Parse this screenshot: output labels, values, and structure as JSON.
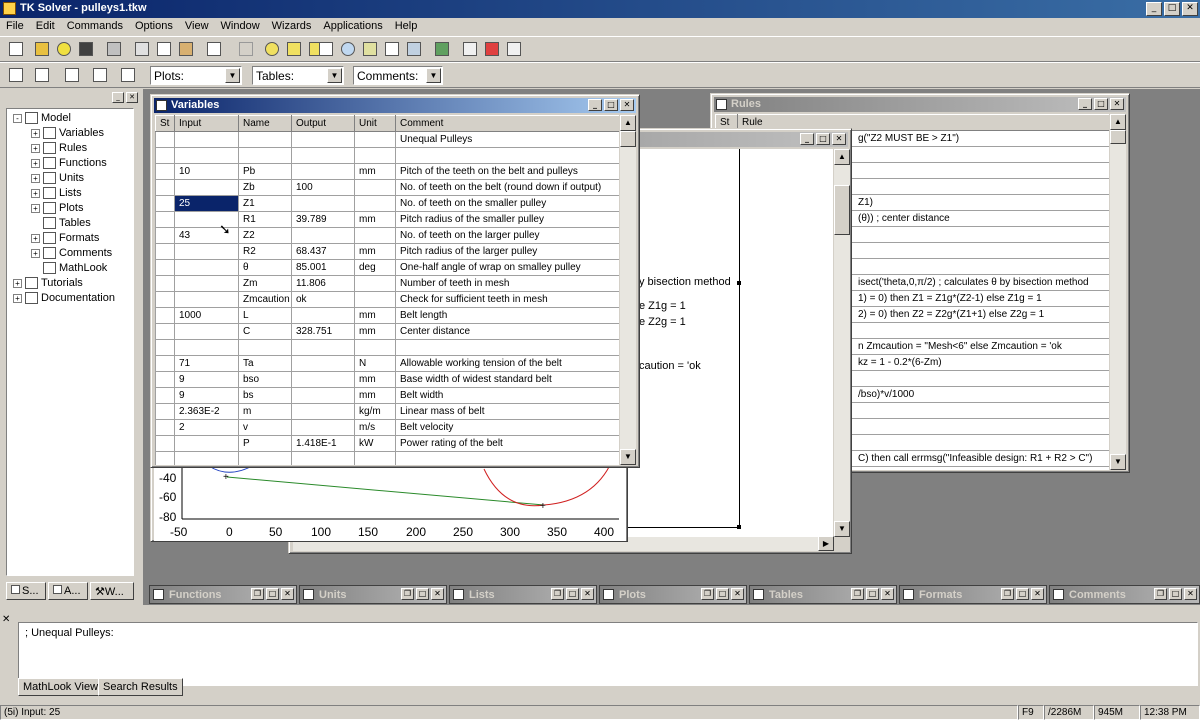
{
  "app": {
    "title": "TK Solver - pulleys1.tkw",
    "menu": [
      "File",
      "Edit",
      "Commands",
      "Options",
      "View",
      "Window",
      "Wizards",
      "Applications",
      "Help"
    ]
  },
  "toolbar2": {
    "plots": "Plots:",
    "tables": "Tables:",
    "comments": "Comments:"
  },
  "tree": {
    "items": [
      {
        "label": "Model",
        "level": 0,
        "expander": "-",
        "icon": "model-icon"
      },
      {
        "label": "Variables",
        "level": 1,
        "expander": "+",
        "icon": "variables-icon"
      },
      {
        "label": "Rules",
        "level": 1,
        "expander": "+",
        "icon": "rules-icon"
      },
      {
        "label": "Functions",
        "level": 1,
        "expander": "+",
        "icon": "functions-icon"
      },
      {
        "label": "Units",
        "level": 1,
        "expander": "+",
        "icon": "units-icon"
      },
      {
        "label": "Lists",
        "level": 1,
        "expander": "+",
        "icon": "lists-icon"
      },
      {
        "label": "Plots",
        "level": 1,
        "expander": "+",
        "icon": "plots-icon"
      },
      {
        "label": "Tables",
        "level": 1,
        "expander": "",
        "icon": "tables-icon"
      },
      {
        "label": "Formats",
        "level": 1,
        "expander": "+",
        "icon": "formats-icon"
      },
      {
        "label": "Comments",
        "level": 1,
        "expander": "+",
        "icon": "comments-icon"
      },
      {
        "label": "MathLook",
        "level": 1,
        "expander": "",
        "icon": "mathlook-icon"
      },
      {
        "label": "Tutorials",
        "level": 0,
        "expander": "+",
        "icon": "tutorials-icon"
      },
      {
        "label": "Documentation",
        "level": 0,
        "expander": "+",
        "icon": "documentation-icon"
      }
    ],
    "tabs": [
      "S...",
      "A...",
      "W..."
    ]
  },
  "variables": {
    "title": "Variables",
    "headers": [
      "St",
      "Input",
      "Name",
      "Output",
      "Unit",
      "Comment"
    ],
    "rows": [
      [
        "",
        "",
        "",
        "",
        "",
        "Unequal Pulleys"
      ],
      [
        "",
        "",
        "",
        "",
        "",
        ""
      ],
      [
        "",
        "10",
        "Pb",
        "",
        "mm",
        "Pitch of the teeth on the belt and pulleys"
      ],
      [
        "",
        "",
        "Zb",
        "100",
        "",
        "No. of teeth on the belt (round down if output)"
      ],
      [
        "",
        "25",
        "Z1",
        "",
        "",
        "No. of teeth on the smaller pulley"
      ],
      [
        "",
        "",
        "R1",
        "39.789",
        "mm",
        "Pitch radius of the smaller pulley"
      ],
      [
        "",
        "43",
        "Z2",
        "",
        "",
        "No. of teeth on the larger pulley"
      ],
      [
        "",
        "",
        "R2",
        "68.437",
        "mm",
        "Pitch radius of the larger pulley"
      ],
      [
        "",
        "",
        "θ",
        "85.001",
        "deg",
        "One-half angle of wrap on smalley pulley"
      ],
      [
        "",
        "",
        "Zm",
        "11.806",
        "",
        "Number of teeth in mesh"
      ],
      [
        "",
        "",
        "Zmcaution",
        "ok",
        "",
        "Check for sufficient teeth in mesh"
      ],
      [
        "",
        "1000",
        "L",
        "",
        "mm",
        "Belt length"
      ],
      [
        "",
        "",
        "C",
        "328.751",
        "mm",
        "Center distance"
      ],
      [
        "",
        "",
        "",
        "",
        "",
        ""
      ],
      [
        "",
        "71",
        "Ta",
        "",
        "N",
        "Allowable working tension of the belt"
      ],
      [
        "",
        "9",
        "bso",
        "",
        "mm",
        "Base width of widest standard belt"
      ],
      [
        "",
        "9",
        "bs",
        "",
        "mm",
        "Belt width"
      ],
      [
        "",
        "2.363E-2",
        "m",
        "",
        "kg/m",
        "Linear mass of belt"
      ],
      [
        "",
        "2",
        "v",
        "",
        "m/s",
        "Belt velocity"
      ],
      [
        "",
        "",
        "P",
        "1.418E-1",
        "kW",
        "Power rating of the belt"
      ],
      [
        "",
        "",
        "",
        "",
        "",
        ""
      ]
    ]
  },
  "rules": {
    "title": "Rules",
    "headers": [
      "St",
      "Rule"
    ],
    "lines": [
      "g(\"Z2 MUST BE > Z1\")",
      "",
      "",
      "",
      "Z1)",
      "(θ))  ; center distance",
      "",
      "",
      "",
      "isect('theta,0,π/2)  ;  calculates θ by bisection method",
      "1) = 0) then Z1 = Z1g*(Z2-1) else Z1g = 1",
      "2) = 0) then Z2 = Z2g*(Z1+1) else Z2g = 1",
      "",
      "n Zmcaution = \"Mesh<6\" else Zmcaution = 'ok",
      " kz = 1 - 0.2*(6-Zm)",
      "",
      "/bso)*v/1000",
      "",
      "",
      "",
      "C) then call errmsg(\"Infeasible design: R1 + R2 > C\")"
    ]
  },
  "mathlook": {
    "lines": [
      "y bisection method",
      "e Z1g = 1",
      "e Z2g = 1",
      "",
      "caution = 'ok"
    ]
  },
  "plot": {
    "yticks": [
      "-40",
      "-60",
      "-80"
    ],
    "xticks": [
      "-50",
      "0",
      "50",
      "100",
      "150",
      "200",
      "250",
      "300",
      "350",
      "400"
    ]
  },
  "minimized": [
    "Functions",
    "Units",
    "Lists",
    "Plots",
    "Tables",
    "Formats",
    "Comments"
  ],
  "bottom": {
    "mathlook_text": ";  Unequal Pulleys:",
    "tabs": [
      "MathLook View",
      "Search Results"
    ]
  },
  "status": {
    "left": "(5i) Input: 25",
    "key": "F9",
    "mem1": "/2286M",
    "mem2": "945M",
    "time": "12:38 PM"
  }
}
